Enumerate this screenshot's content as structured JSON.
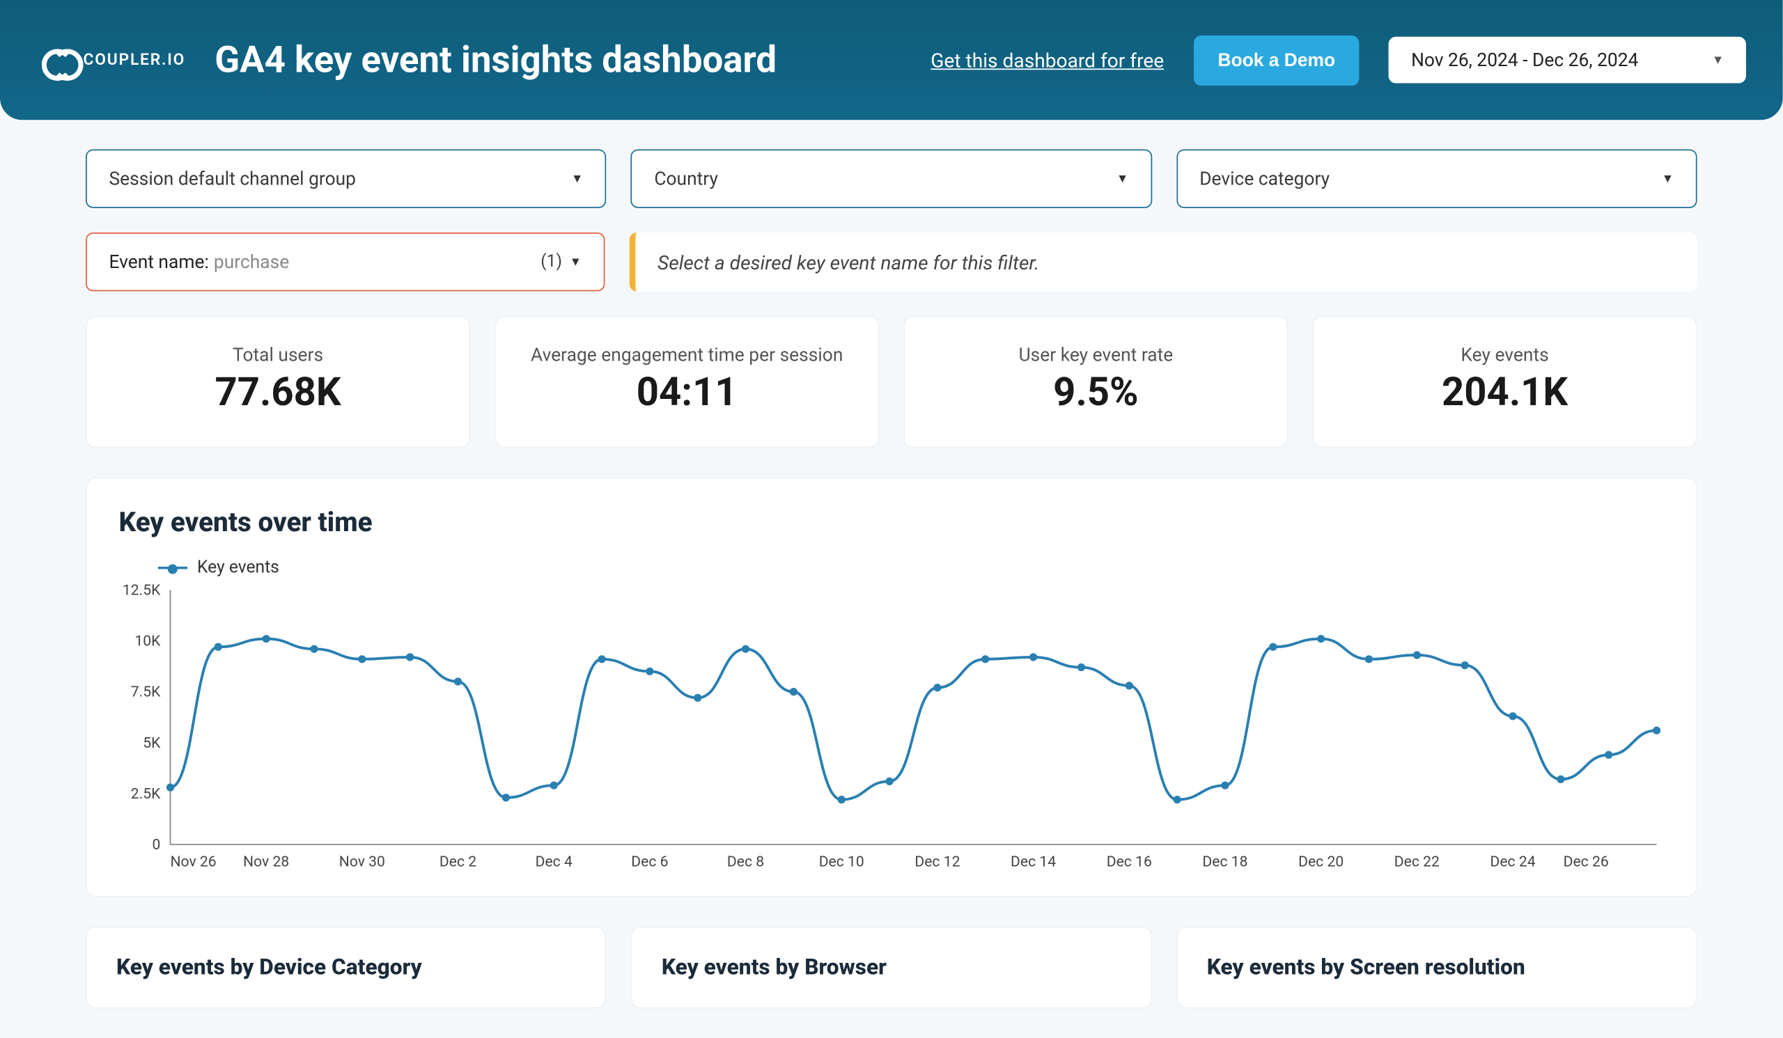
{
  "brand": {
    "name": "COUPLER.IO"
  },
  "header": {
    "title": "GA4 key event insights dashboard",
    "get_free_link": "Get this dashboard for free",
    "demo_button": "Book a Demo",
    "date_range": "Nov 26, 2024 - Dec 26, 2024"
  },
  "filters": {
    "channel_group": {
      "label": "Session default channel group"
    },
    "country": {
      "label": "Country"
    },
    "device_cat": {
      "label": "Device category"
    },
    "event_name": {
      "label": "Event name",
      "value": "purchase",
      "count": "(1)"
    }
  },
  "hint": "Select a desired key event name for this filter.",
  "metrics": [
    {
      "label": "Total users",
      "value": "77.68K"
    },
    {
      "label": "Average engagement time per session",
      "value": "04:11"
    },
    {
      "label": "User key event rate",
      "value": "9.5%"
    },
    {
      "label": "Key events",
      "value": "204.1K"
    }
  ],
  "chart_title": "Key events over time",
  "legend_label": "Key events",
  "lower_titles": {
    "device": "Key events by Device Category",
    "browser": "Key events by Browser",
    "screen": "Key events by Screen resolution"
  },
  "chart_data": {
    "type": "line",
    "title": "Key events over time",
    "xlabel": "",
    "ylabel": "",
    "ylim": [
      0,
      12500
    ],
    "y_ticks": [
      "0",
      "2.5K",
      "5K",
      "7.5K",
      "10K",
      "12.5K"
    ],
    "x_ticks": [
      "Nov 26",
      "Nov 28",
      "Nov 30",
      "Dec 2",
      "Dec 4",
      "Dec 6",
      "Dec 8",
      "Dec 10",
      "Dec 12",
      "Dec 14",
      "Dec 16",
      "Dec 18",
      "Dec 20",
      "Dec 22",
      "Dec 24",
      "Dec 26"
    ],
    "series": [
      {
        "name": "Key events",
        "x": [
          "Nov 26",
          "Nov 27",
          "Nov 28",
          "Nov 29",
          "Nov 30",
          "Dec 1",
          "Dec 2",
          "Dec 3",
          "Dec 4",
          "Dec 5",
          "Dec 6",
          "Dec 7",
          "Dec 8",
          "Dec 9",
          "Dec 10",
          "Dec 11",
          "Dec 12",
          "Dec 13",
          "Dec 14",
          "Dec 15",
          "Dec 16",
          "Dec 17",
          "Dec 18",
          "Dec 19",
          "Dec 20",
          "Dec 21",
          "Dec 22",
          "Dec 23",
          "Dec 24",
          "Dec 25",
          "Dec 26"
        ],
        "values": [
          2800,
          9700,
          10100,
          9600,
          9100,
          9200,
          8000,
          2300,
          2900,
          9100,
          8500,
          7200,
          9600,
          7500,
          2200,
          3100,
          7700,
          9100,
          9200,
          8700,
          7800,
          2200,
          2900,
          9700,
          10100,
          9100,
          9300,
          8800,
          6300,
          3200,
          4400,
          5600
        ]
      }
    ]
  }
}
